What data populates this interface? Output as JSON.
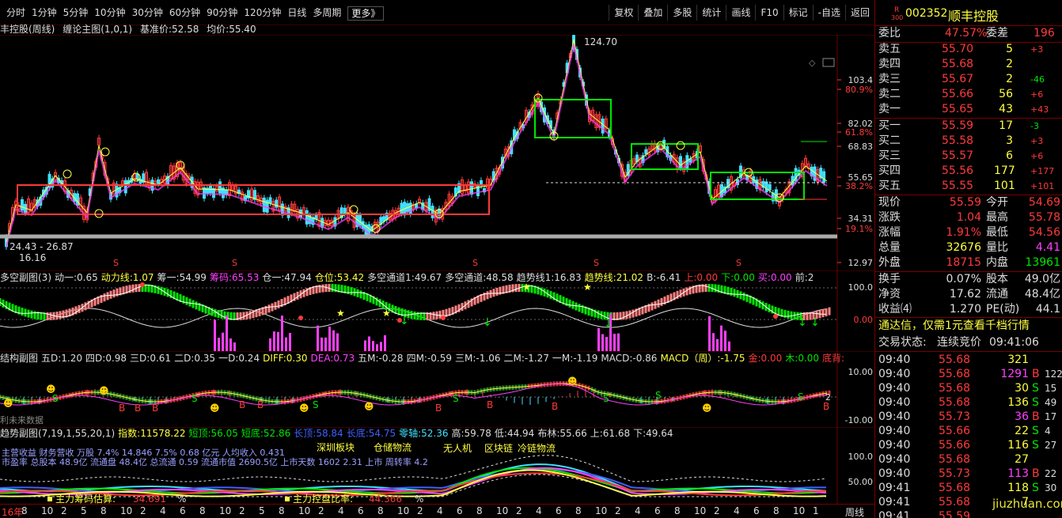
{
  "periods": [
    "分时",
    "1分钟",
    "5分钟",
    "10分钟",
    "30分钟",
    "60分钟",
    "90分钟",
    "120分钟",
    "日线",
    "多周期",
    "更多》"
  ],
  "tools": [
    "复权",
    "叠加",
    "多股",
    "统计",
    "画线",
    "F10",
    "标记",
    "-自选",
    "返回"
  ],
  "main": {
    "title": "丰控股(周线)",
    "indicator": "缠论主图(1,0,1)",
    "base_label": "基准价:",
    "base": "52.58",
    "avg_label": "均价:",
    "avg": "55.40",
    "peak": "124.70",
    "low_range": "24.43 - 26.87",
    "low": "16.16",
    "ticks": [
      "103.4",
      "80.9%",
      "82.02",
      "61.8%",
      "68.83",
      "55.65",
      "38.2%",
      "34.31",
      "19.1%",
      "12.97"
    ]
  },
  "sub1": {
    "name": "多空副图(3)",
    "items": [
      [
        "动一:",
        "0.65",
        "#ddd"
      ],
      [
        "动力线:",
        "1.07",
        "#ffff40"
      ],
      [
        "筹一:",
        "54.99",
        "#ddd"
      ],
      [
        "筹码:",
        "65.53",
        "#ff40ff"
      ],
      [
        "仓一:",
        "47.94",
        "#ddd"
      ],
      [
        "仓位:",
        "53.42",
        "#ffff40"
      ],
      [
        "多空通道1:",
        "49.67",
        "#ddd"
      ],
      [
        "多空通道:",
        "48.58",
        "#ddd"
      ],
      [
        "趋势线1:",
        "16.83",
        "#ddd"
      ],
      [
        "趋势线:",
        "21.02",
        "#ffff40"
      ],
      [
        "B:",
        "-6.41",
        "#ddd"
      ],
      [
        "上:",
        "0.00",
        "#ff3a3a"
      ],
      [
        "下:",
        "0.00",
        "#00e600"
      ],
      [
        "买:",
        "0.00",
        "#ff40ff"
      ],
      [
        "前:",
        "2",
        "#ddd"
      ]
    ],
    "ticks": [
      "100.0",
      "0.00"
    ]
  },
  "sub2": {
    "name": "结构副图",
    "items": [
      [
        "五D:",
        "1.20",
        "#ddd"
      ],
      [
        "四D:",
        "0.98",
        "#ddd"
      ],
      [
        "三D:",
        "0.61",
        "#ddd"
      ],
      [
        "二D:",
        "0.35",
        "#ddd"
      ],
      [
        "一D:",
        "0.24",
        "#ddd"
      ],
      [
        "DIFF:",
        "0.30",
        "#ffff40"
      ],
      [
        "DEA:",
        "0.73",
        "#ff40ff"
      ],
      [
        "五M:",
        "-0.28",
        "#ddd"
      ],
      [
        "四M:",
        "-0.59",
        "#ddd"
      ],
      [
        "三M:",
        "-1.06",
        "#ddd"
      ],
      [
        "二M:",
        "-1.27",
        "#ddd"
      ],
      [
        "一M:",
        "-1.19",
        "#ddd"
      ],
      [
        "MACD:",
        "-0.86",
        "#ddd"
      ],
      [
        "MACD（周）:",
        "-1.75",
        "#ffff40"
      ],
      [
        "金:",
        "0.00",
        "#ff3a3a"
      ],
      [
        "木:",
        "0.00",
        "#00e600"
      ],
      [
        "底背:",
        "",
        "#ff3a3a"
      ]
    ],
    "note": "利未来数据",
    "ticks": [
      "10.00",
      "2",
      "-10.00"
    ]
  },
  "sub3": {
    "name": "趋势副图(7,19,1,55,20,1)",
    "items": [
      [
        "指数:",
        "11578.22",
        "#ffff40"
      ],
      [
        "短顶:",
        "56.05",
        "#00e600"
      ],
      [
        "短底:",
        "52.86",
        "#00e600"
      ],
      [
        "长顶:",
        "58.84",
        "#4060ff"
      ],
      [
        "长底:",
        "54.75",
        "#4060ff"
      ],
      [
        "零轴:",
        "52.36",
        "#40e0ff"
      ],
      [
        "高:",
        "59.78",
        "#ddd"
      ],
      [
        "低:",
        "44.94",
        "#ddd"
      ],
      [
        "布林:",
        "55.66",
        "#ddd"
      ],
      [
        "上:",
        "61.68",
        "#ddd"
      ],
      [
        "下:",
        "49.64",
        "#ddd"
      ]
    ],
    "line1": "主营收益 财务营收 万股 7.4% 14.846 7.5% 0.68 亿元 人均收入 0.431",
    "line2": "市盈率 总股本 48.9亿 流通盘 48.4亿 总流通 0.59 流通市值 2690.5亿 上市天数 1602 2.31 上市 周转率 4.2",
    "concepts": [
      "深圳板块",
      "仓储物流",
      "无人机",
      "区块链",
      "冷链物流"
    ],
    "est_label": "主力筹码估算:",
    "est_val": "34.691",
    "est_pct": "%",
    "ctrl_label": "主力控盘比率:",
    "ctrl_val": "44.366",
    "ctrl_pct": "%",
    "ticks": [
      "100.0",
      "50.00"
    ]
  },
  "xaxis": [
    "16年",
    "8",
    "10",
    "2",
    "5",
    "8",
    "10",
    "2",
    "4",
    "6",
    "8",
    "10",
    "2",
    "5",
    "8",
    "10",
    "2",
    "4",
    "6",
    "8",
    "10",
    "2",
    "4",
    "6",
    "8",
    "10",
    "2",
    "4",
    "6",
    "8",
    "10",
    "2",
    "4",
    "6",
    "8",
    "10",
    "2",
    "4",
    "6",
    "8",
    "10",
    "1"
  ],
  "period_label": "周线",
  "quote": {
    "badge_top": "R",
    "badge_bot": "300",
    "code": "002352",
    "name": "顺丰控股",
    "wb_label": "委比",
    "wb": "47.57%",
    "wc_label": "委差",
    "wc": "196",
    "asks": [
      [
        "卖五",
        "55.70",
        "5",
        "+3"
      ],
      [
        "卖四",
        "55.68",
        "2",
        ""
      ],
      [
        "卖三",
        "55.67",
        "2",
        "-46"
      ],
      [
        "卖二",
        "55.66",
        "56",
        "+6"
      ],
      [
        "卖一",
        "55.65",
        "43",
        "+43"
      ]
    ],
    "bids": [
      [
        "买一",
        "55.59",
        "17",
        "-3"
      ],
      [
        "买二",
        "55.58",
        "3",
        "+3"
      ],
      [
        "买三",
        "55.57",
        "6",
        "+6"
      ],
      [
        "买四",
        "55.56",
        "177",
        "+177"
      ],
      [
        "买五",
        "55.55",
        "101",
        "+101"
      ]
    ],
    "stats": [
      [
        "现价",
        "55.59",
        "今开",
        "54.69"
      ],
      [
        "涨跌",
        "1.04",
        "最高",
        "55.78"
      ],
      [
        "涨幅",
        "1.91%",
        "最低",
        "54.56"
      ],
      [
        "总量",
        "32676",
        "量比",
        "4.41"
      ],
      [
        "外盘",
        "18715",
        "内盘",
        "13961"
      ]
    ],
    "stats2": [
      [
        "换手",
        "0.07%",
        "股本",
        "49.0亿"
      ],
      [
        "净资",
        "17.62",
        "流通",
        "48.4亿"
      ],
      [
        "收益⑷",
        "1.270",
        "PE(动)",
        "44.1"
      ]
    ],
    "promo": "通达信，仅需1元查看千档行情",
    "status_label": "交易状态:",
    "status": "连续竞价",
    "status_time": "09:41:06",
    "ticks": [
      [
        "09:40",
        "55.68",
        "321",
        ""
      ],
      [
        "09:40",
        "55.68",
        "1291",
        "B",
        "122"
      ],
      [
        "09:40",
        "55.68",
        "30",
        "S",
        "15"
      ],
      [
        "09:40",
        "55.68",
        "136",
        "S",
        "49"
      ],
      [
        "09:40",
        "55.73",
        "36",
        "B",
        "17"
      ],
      [
        "09:40",
        "55.66",
        "22",
        "S",
        "4"
      ],
      [
        "09:40",
        "55.66",
        "116",
        "S",
        "27"
      ],
      [
        "09:40",
        "55.68",
        "27",
        "",
        ""
      ],
      [
        "09:40",
        "55.73",
        "113",
        "B",
        "22"
      ],
      [
        "09:41",
        "55.68",
        "118",
        "S",
        "30"
      ],
      [
        "09:41",
        "55.68",
        "7",
        "",
        ""
      ],
      [
        "09:41",
        "55.59",
        "",
        ""
      ]
    ],
    "watermark": "jiuzhuan.com"
  },
  "colors": {
    "red": "#ff3a3a",
    "green": "#00e600",
    "yellow": "#ffff40",
    "magenta": "#ff40ff",
    "cyan": "#40e0ff",
    "frame": "#700000"
  }
}
